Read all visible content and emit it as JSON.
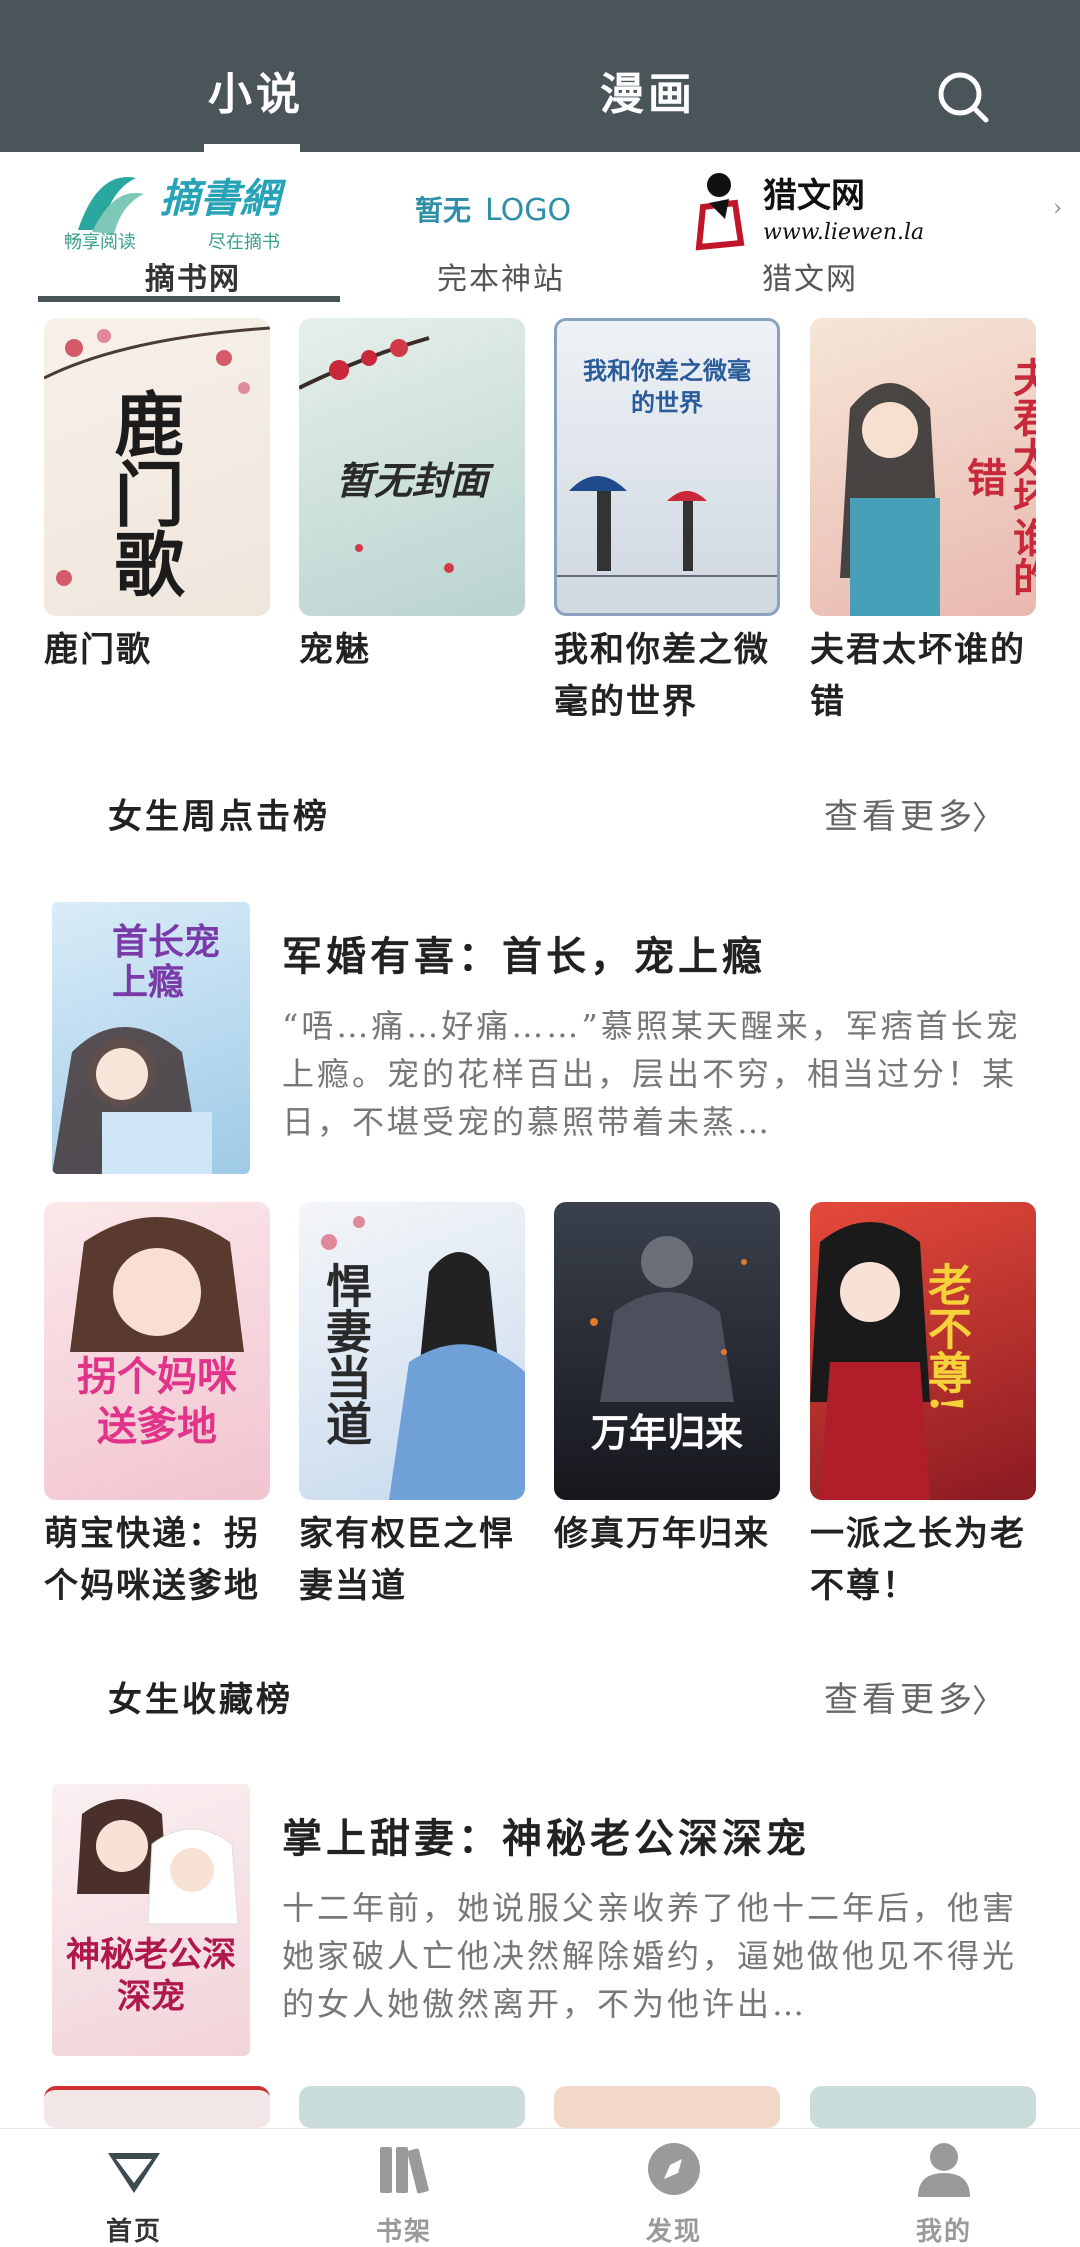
{
  "top_tabs": [
    {
      "label": "小说",
      "active": true
    },
    {
      "label": "漫画",
      "active": false
    }
  ],
  "sources": [
    {
      "label": "摘书网",
      "logo_main": "摘書網",
      "logo_sub1": "畅享阅读",
      "logo_sub2": "尽在摘书",
      "active": true
    },
    {
      "label": "完本神站",
      "logo_main": "暂无",
      "logo_sub1": "LOGO",
      "active": false
    },
    {
      "label": "猎文网",
      "logo_main": "猎文网",
      "logo_sub1": "www.liewen.la",
      "active": false
    }
  ],
  "row1": [
    {
      "title": "鹿门歌",
      "cover_text": "鹿门歌",
      "cover_bg": "#f4efe9"
    },
    {
      "title": "宠魅",
      "cover_text": "暂无封面",
      "cover_bg": "#c9dcd9"
    },
    {
      "title": "我和你差之微毫的世界",
      "cover_text": "我和你差之微毫的世界",
      "cover_bg": "#dde3ea"
    },
    {
      "title": "夫君太坏谁的错",
      "cover_text": "夫君太坏谁的错",
      "cover_bg": "#f0d9cf"
    }
  ],
  "section1": {
    "title": "女生周点击榜",
    "more": "查看更多"
  },
  "feature1": {
    "title": "军婚有喜：首长，宠上瘾",
    "desc": "“唔…痛…好痛……”慕照某天醒来，军痞首长宠上瘾。宠的花样百出，层出不穷，相当过分！某日，不堪受宠的慕照带着未蒸…",
    "cover_text": "首长宠上瘾",
    "cover_bg": "#b8d7ef"
  },
  "row2": [
    {
      "title": "萌宝快递：拐个妈咪送爹地",
      "cover_text": "拐个妈咪送爹地",
      "cover_bg": "#f3d3da"
    },
    {
      "title": "家有权臣之悍妻当道",
      "cover_text": "悍妻当道",
      "cover_bg": "#e8eef5"
    },
    {
      "title": "修真万年归来",
      "cover_text": "万年归来",
      "cover_bg": "#2b2f38"
    },
    {
      "title": "一派之长为老不尊！",
      "cover_text": "老不尊!",
      "cover_bg": "#c4303a"
    }
  ],
  "section2": {
    "title": "女生收藏榜",
    "more": "查看更多"
  },
  "feature2": {
    "title": "掌上甜妻：神秘老公深深宠",
    "desc": "十二年前，她说服父亲收养了他十二年后，他害她家破人亡他决然解除婚约，逼她做他见不得光的女人她傲然离开，不为他许出…",
    "cover_text": "神秘老公深深宠",
    "cover_bg": "#f6e3e6"
  },
  "row3_covers": [
    "#f2e6e6",
    "#c9dcd9",
    "#f1d8c8",
    "#c9dcd9"
  ],
  "bottom_nav": [
    {
      "label": "首页",
      "icon": "home-gem-icon",
      "active": true
    },
    {
      "label": "书架",
      "icon": "bookshelf-icon",
      "active": false
    },
    {
      "label": "发现",
      "icon": "compass-icon",
      "active": false
    },
    {
      "label": "我的",
      "icon": "person-icon",
      "active": false
    }
  ],
  "colors": {
    "topbar": "#4a555a",
    "accent": "#4a555a",
    "text": "#222222",
    "muted": "#777777"
  }
}
